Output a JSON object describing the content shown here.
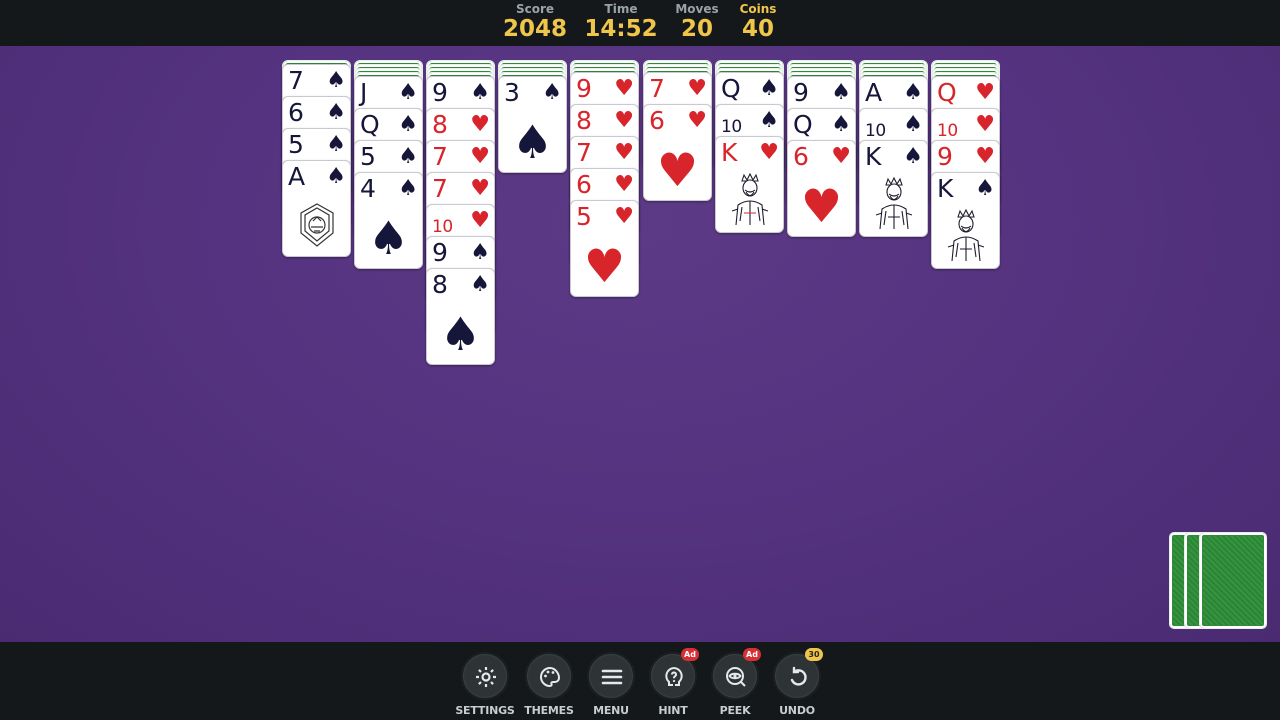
{
  "header": {
    "score": {
      "label": "Score",
      "value": "2048"
    },
    "time": {
      "label": "Time",
      "value": "14:52"
    },
    "moves": {
      "label": "Moves",
      "value": "20"
    },
    "coins": {
      "label": "Coins",
      "value": "40"
    }
  },
  "colors": {
    "table": "#553380",
    "accent": "#f0c64a",
    "card_back": "#2f8a3a",
    "red_suit": "#d8242b",
    "black_suit": "#16163a"
  },
  "tableau": [
    {
      "facedown": 1,
      "cards": [
        {
          "rank": "7",
          "suit": "♠",
          "color": "black"
        },
        {
          "rank": "6",
          "suit": "♠",
          "color": "black"
        },
        {
          "rank": "5",
          "suit": "♠",
          "color": "black"
        },
        {
          "rank": "A",
          "suit": "♠",
          "color": "black",
          "face": "emblem"
        }
      ]
    },
    {
      "facedown": 4,
      "cards": [
        {
          "rank": "J",
          "suit": "♠",
          "color": "black"
        },
        {
          "rank": "Q",
          "suit": "♠",
          "color": "black"
        },
        {
          "rank": "5",
          "suit": "♠",
          "color": "black"
        },
        {
          "rank": "4",
          "suit": "♠",
          "color": "black"
        }
      ]
    },
    {
      "facedown": 4,
      "cards": [
        {
          "rank": "9",
          "suit": "♠",
          "color": "black"
        },
        {
          "rank": "8",
          "suit": "♥",
          "color": "red"
        },
        {
          "rank": "7",
          "suit": "♥",
          "color": "red"
        },
        {
          "rank": "7",
          "suit": "♥",
          "color": "red"
        },
        {
          "rank": "10",
          "suit": "♥",
          "color": "red"
        },
        {
          "rank": "9",
          "suit": "♠",
          "color": "black"
        },
        {
          "rank": "8",
          "suit": "♠",
          "color": "black"
        }
      ]
    },
    {
      "facedown": 4,
      "cards": [
        {
          "rank": "3",
          "suit": "♠",
          "color": "black"
        }
      ]
    },
    {
      "facedown": 3,
      "cards": [
        {
          "rank": "9",
          "suit": "♥",
          "color": "red"
        },
        {
          "rank": "8",
          "suit": "♥",
          "color": "red"
        },
        {
          "rank": "7",
          "suit": "♥",
          "color": "red"
        },
        {
          "rank": "6",
          "suit": "♥",
          "color": "red"
        },
        {
          "rank": "5",
          "suit": "♥",
          "color": "red"
        }
      ]
    },
    {
      "facedown": 3,
      "cards": [
        {
          "rank": "7",
          "suit": "♥",
          "color": "red"
        },
        {
          "rank": "6",
          "suit": "♥",
          "color": "red"
        }
      ]
    },
    {
      "facedown": 3,
      "cards": [
        {
          "rank": "Q",
          "suit": "♠",
          "color": "black"
        },
        {
          "rank": "10",
          "suit": "♠",
          "color": "black"
        },
        {
          "rank": "K",
          "suit": "♥",
          "color": "red",
          "face": "king"
        }
      ]
    },
    {
      "facedown": 4,
      "cards": [
        {
          "rank": "9",
          "suit": "♠",
          "color": "black"
        },
        {
          "rank": "Q",
          "suit": "♠",
          "color": "black"
        },
        {
          "rank": "6",
          "suit": "♥",
          "color": "red"
        }
      ]
    },
    {
      "facedown": 4,
      "cards": [
        {
          "rank": "A",
          "suit": "♠",
          "color": "black"
        },
        {
          "rank": "10",
          "suit": "♠",
          "color": "black"
        },
        {
          "rank": "K",
          "suit": "♠",
          "color": "black",
          "face": "king"
        }
      ]
    },
    {
      "facedown": 4,
      "cards": [
        {
          "rank": "Q",
          "suit": "♥",
          "color": "red"
        },
        {
          "rank": "10",
          "suit": "♥",
          "color": "red"
        },
        {
          "rank": "9",
          "suit": "♥",
          "color": "red"
        },
        {
          "rank": "K",
          "suit": "♠",
          "color": "black",
          "face": "king"
        }
      ]
    }
  ],
  "stock_piles": 3,
  "toolbar": [
    {
      "id": "settings",
      "label": "SETTINGS",
      "icon": "gear-icon",
      "badge": ""
    },
    {
      "id": "themes",
      "label": "THEMES",
      "icon": "palette-icon",
      "badge": ""
    },
    {
      "id": "menu",
      "label": "MENU",
      "icon": "hamburger-icon",
      "badge": ""
    },
    {
      "id": "hint",
      "label": "HINT",
      "icon": "hint-icon",
      "badge": "Ad",
      "badge_type": "ad"
    },
    {
      "id": "peek",
      "label": "PEEK",
      "icon": "eye-icon",
      "badge": "Ad",
      "badge_type": "ad"
    },
    {
      "id": "undo",
      "label": "UNDO",
      "icon": "undo-icon",
      "badge": "30",
      "badge_type": "num"
    }
  ]
}
